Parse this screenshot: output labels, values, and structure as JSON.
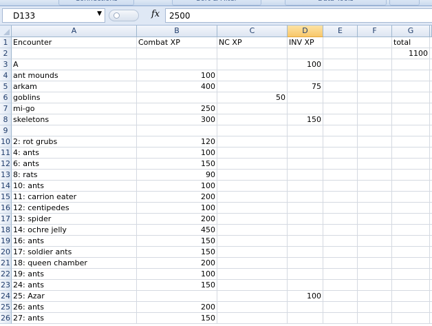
{
  "ribbon": {
    "groups": [
      "Connections",
      "Sort & Filter",
      "Data Tools"
    ]
  },
  "formula_bar": {
    "name_box": "D133",
    "fx_label": "fx",
    "formula": "2500"
  },
  "sheet": {
    "active_column": "D",
    "columns": [
      "A",
      "B",
      "C",
      "D",
      "E",
      "F",
      "G"
    ],
    "rows": [
      {
        "n": "1",
        "A": "Encounter",
        "B": "Combat XP",
        "C": "NC XP",
        "D": "INV XP",
        "G": "total"
      },
      {
        "n": "2",
        "G": "1100"
      },
      {
        "n": "3",
        "A": "A",
        "D": "100"
      },
      {
        "n": "4",
        "A": "ant mounds",
        "B": "100"
      },
      {
        "n": "5",
        "A": "arkam",
        "B": "400",
        "D": "75"
      },
      {
        "n": "6",
        "A": "goblins",
        "C": "50"
      },
      {
        "n": "7",
        "A": "mi-go",
        "B": "250"
      },
      {
        "n": "8",
        "A": "skeletons",
        "B": "300",
        "D": "150"
      },
      {
        "n": "9"
      },
      {
        "n": "10",
        "A": "2: rot grubs",
        "B": "120"
      },
      {
        "n": "11",
        "A": "4: ants",
        "B": "100"
      },
      {
        "n": "12",
        "A": "6: ants",
        "B": "150"
      },
      {
        "n": "13",
        "A": "8: rats",
        "B": "90"
      },
      {
        "n": "14",
        "A": "10: ants",
        "B": "100"
      },
      {
        "n": "15",
        "A": "11: carrion eater",
        "B": "200"
      },
      {
        "n": "16",
        "A": "12: centipedes",
        "B": "100"
      },
      {
        "n": "17",
        "A": "13: spider",
        "B": "200"
      },
      {
        "n": "18",
        "A": "14: ochre jelly",
        "B": "450"
      },
      {
        "n": "19",
        "A": "16: ants",
        "B": "150"
      },
      {
        "n": "20",
        "A": "17: soldier ants",
        "B": "150"
      },
      {
        "n": "21",
        "A": "18: queen chamber",
        "B": "200"
      },
      {
        "n": "22",
        "A": "19: ants",
        "B": "100"
      },
      {
        "n": "23",
        "A": "24: ants",
        "B": "150"
      },
      {
        "n": "24",
        "A": "25: Azar",
        "D": "100"
      },
      {
        "n": "25",
        "A": "26: ants",
        "B": "200"
      },
      {
        "n": "26",
        "A": "27: ants",
        "B": "150"
      }
    ]
  }
}
